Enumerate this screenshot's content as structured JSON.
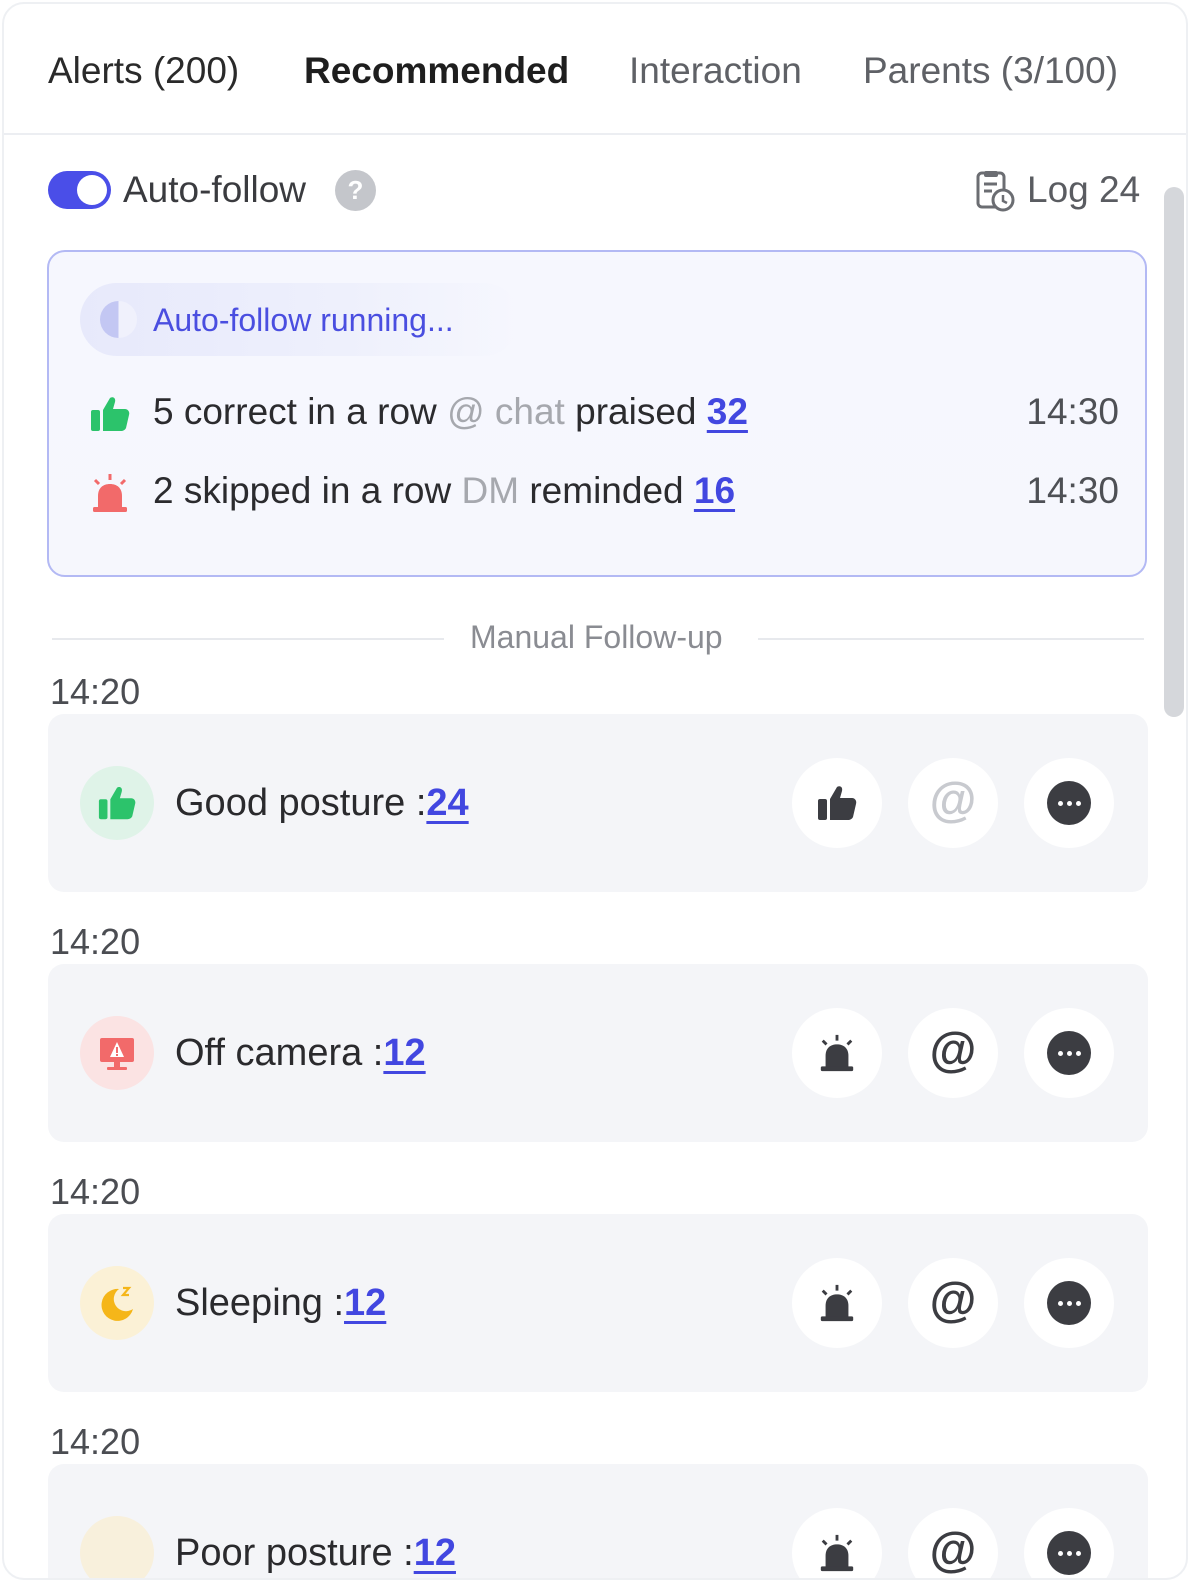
{
  "tabs": [
    {
      "label": "Alerts (200)"
    },
    {
      "label": "Recommended"
    },
    {
      "label": "Interaction"
    },
    {
      "label": "Parents (3/100)"
    }
  ],
  "active_tab": "Recommended",
  "auto_follow": {
    "enabled": true,
    "label": "Auto-follow",
    "help": "?",
    "log_label": "Log 24"
  },
  "running": {
    "status": "Auto-follow running...",
    "rows": [
      {
        "icon": "thumbs-up-icon",
        "condition": "5 correct in a row",
        "channel": "@ chat",
        "action": "praised",
        "count": "32",
        "time": "14:30"
      },
      {
        "icon": "alarm-icon",
        "condition": "2 skipped in a row",
        "channel": "DM",
        "action": "reminded",
        "count": "16",
        "time": "14:30"
      }
    ]
  },
  "divider": "Manual Follow-up",
  "items": [
    {
      "time": "14:20",
      "label": "Good posture :",
      "count": "24",
      "icon": "thumbs-up-icon",
      "badge_color": "#dff3e8",
      "actions": [
        "thumbs-up-icon",
        "at-icon",
        "chat-icon"
      ]
    },
    {
      "time": "14:20",
      "label": "Off camera :",
      "count": "12",
      "icon": "monitor-alert-icon",
      "badge_color": "#fbe3e3",
      "actions": [
        "alarm-icon",
        "at-icon",
        "chat-icon"
      ]
    },
    {
      "time": "14:20",
      "label": "Sleeping :",
      "count": "12",
      "icon": "moon-icon",
      "badge_color": "#fbf1d6",
      "actions": [
        "alarm-icon",
        "at-icon",
        "chat-icon"
      ]
    },
    {
      "time": "14:20",
      "label": "Poor posture :",
      "count": "12",
      "icon": "posture-icon",
      "badge_color": "#f8f0dc",
      "actions": [
        "alarm-icon",
        "at-icon",
        "chat-icon"
      ]
    }
  ],
  "colors": {
    "accent": "#4a4ee8",
    "link": "#4247e0",
    "green": "#2cc36b",
    "red": "#f26a6a",
    "yellow": "#f5b619"
  }
}
